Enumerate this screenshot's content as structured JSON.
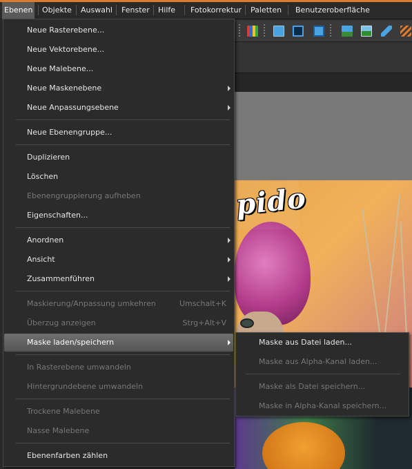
{
  "menubar": {
    "items": [
      "Ebenen",
      "Objekte",
      "Auswahl",
      "Fenster",
      "Hilfe",
      "Fotokorrektur",
      "Paletten",
      "Benutzeroberfläche"
    ],
    "accent_color": "#e07a2b"
  },
  "watermark": {
    "text": "by pido"
  },
  "layer_menu": {
    "items": [
      {
        "label": "Neue Rasterebene...",
        "enabled": true
      },
      {
        "label": "Neue Vektorebene...",
        "enabled": true
      },
      {
        "label": "Neue Malebene...",
        "enabled": true
      },
      {
        "label": "Neue Maskenebene",
        "enabled": true,
        "submenu": true
      },
      {
        "label": "Neue Anpassungsebene",
        "enabled": true,
        "submenu": true
      },
      {
        "label": "Neue Ebenengruppe...",
        "enabled": true
      },
      {
        "label": "Duplizieren",
        "enabled": true
      },
      {
        "label": "Löschen",
        "enabled": true
      },
      {
        "label": "Ebenengruppierung aufheben",
        "enabled": false
      },
      {
        "label": "Eigenschaften...",
        "enabled": true
      },
      {
        "label": "Anordnen",
        "enabled": true,
        "submenu": true
      },
      {
        "label": "Ansicht",
        "enabled": true,
        "submenu": true
      },
      {
        "label": "Zusammenführen",
        "enabled": true,
        "submenu": true
      },
      {
        "label": "Maskierung/Anpassung umkehren",
        "enabled": false,
        "shortcut": "Umschalt+K"
      },
      {
        "label": "Überzug anzeigen",
        "enabled": false,
        "shortcut": "Strg+Alt+V"
      },
      {
        "label": "Maske laden/speichern",
        "enabled": true,
        "submenu": true,
        "highlighted": true
      },
      {
        "label": "In Rasterebene umwandeln",
        "enabled": false
      },
      {
        "label": "Hintergrundebene umwandeln",
        "enabled": false
      },
      {
        "label": "Trockene Malebene",
        "enabled": false
      },
      {
        "label": "Nasse Malebene",
        "enabled": false
      },
      {
        "label": "Ebenenfarben zählen",
        "enabled": true
      }
    ]
  },
  "mask_submenu": {
    "items": [
      {
        "label": "Maske aus Datei laden...",
        "enabled": true
      },
      {
        "label": "Maske aus Alpha-Kanal laden...",
        "enabled": false
      },
      {
        "label": "Maske als Datei speichern...",
        "enabled": false
      },
      {
        "label": "Maske in Alpha-Kanal speichern...",
        "enabled": false
      }
    ]
  }
}
